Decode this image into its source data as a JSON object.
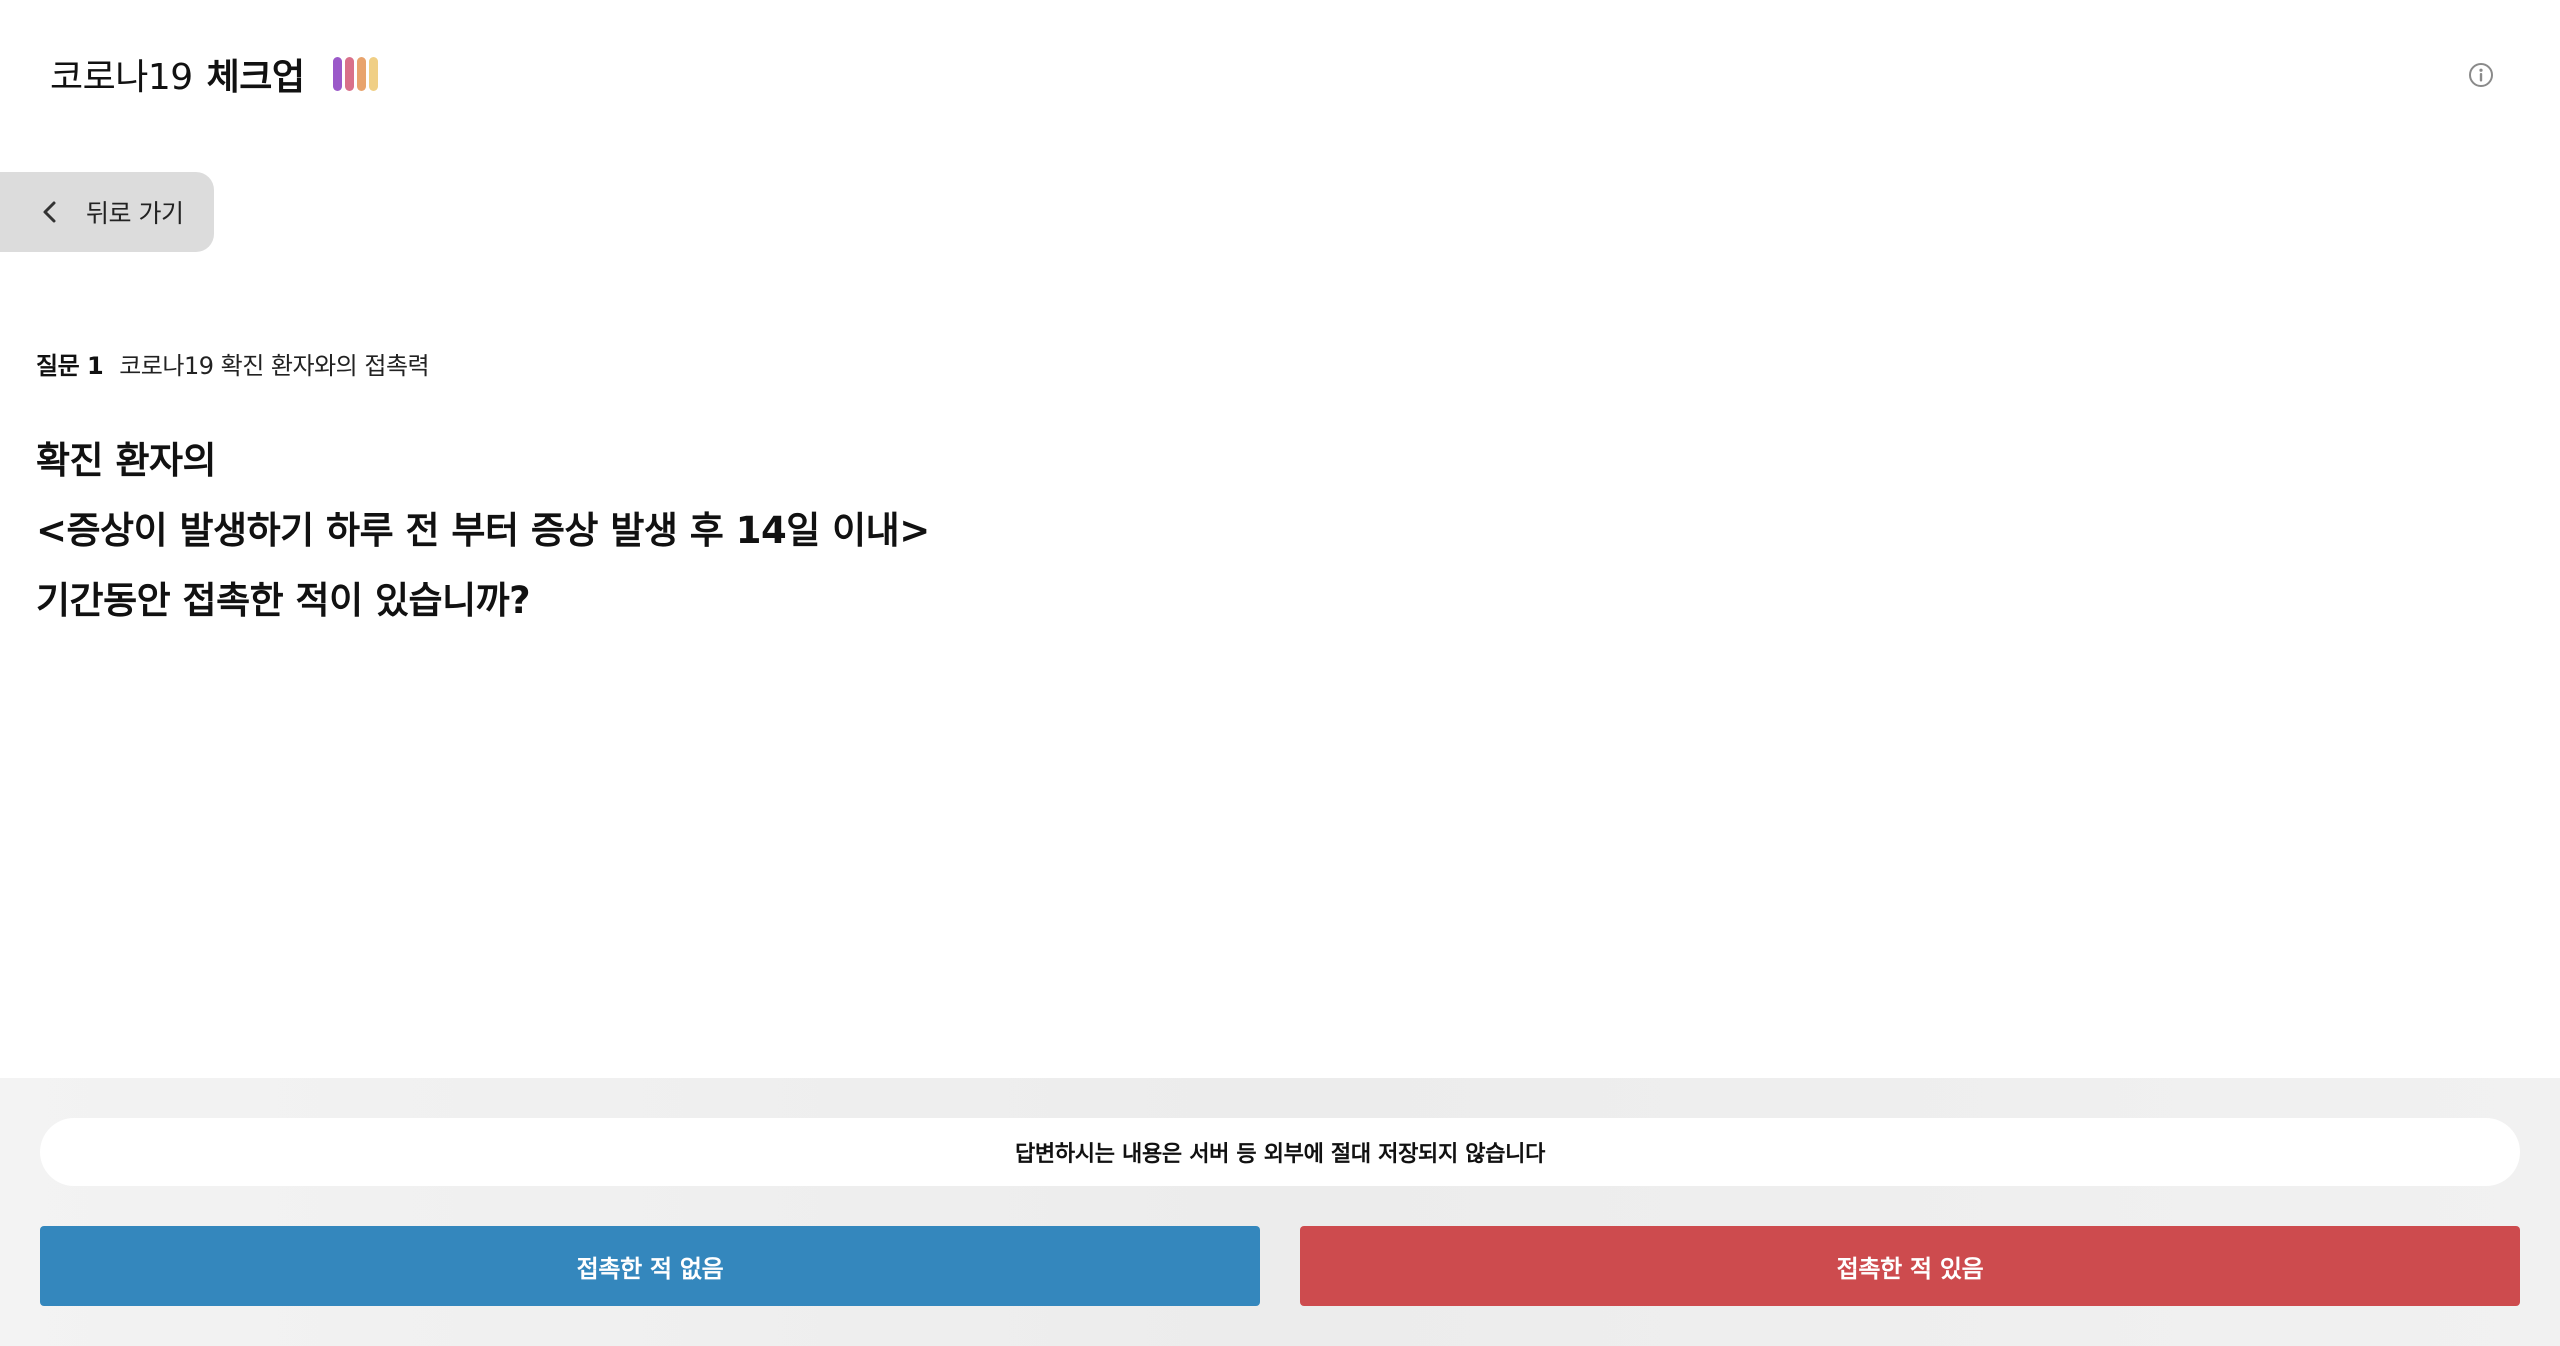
{
  "header": {
    "logo_light": "코로나19",
    "logo_bold": "체크업",
    "logo_bar_colors": [
      "#9b59c9",
      "#d9708a",
      "#e8a36c",
      "#f0cf85"
    ],
    "info_icon": "info-circle-icon"
  },
  "back": {
    "label": "뒤로 가기",
    "icon": "chevron-left-icon"
  },
  "question": {
    "number": "질문 1",
    "category": "코로나19 확진 환자와의 접촉력",
    "lines": [
      "확진 환자의",
      "<증상이 발생하기 하루 전 부터 증상 발생 후 14일 이내>",
      "기간동안 접촉한 적이 있습니까?"
    ]
  },
  "footer": {
    "privacy_notice": "답변하시는 내용은 서버 등 외부에 절대 저장되지 않습니다",
    "answer_no": "접촉한 적 없음",
    "answer_yes": "접촉한 적 있음",
    "answer_no_color": "#3487bd",
    "answer_yes_color": "#cd4b4e"
  }
}
